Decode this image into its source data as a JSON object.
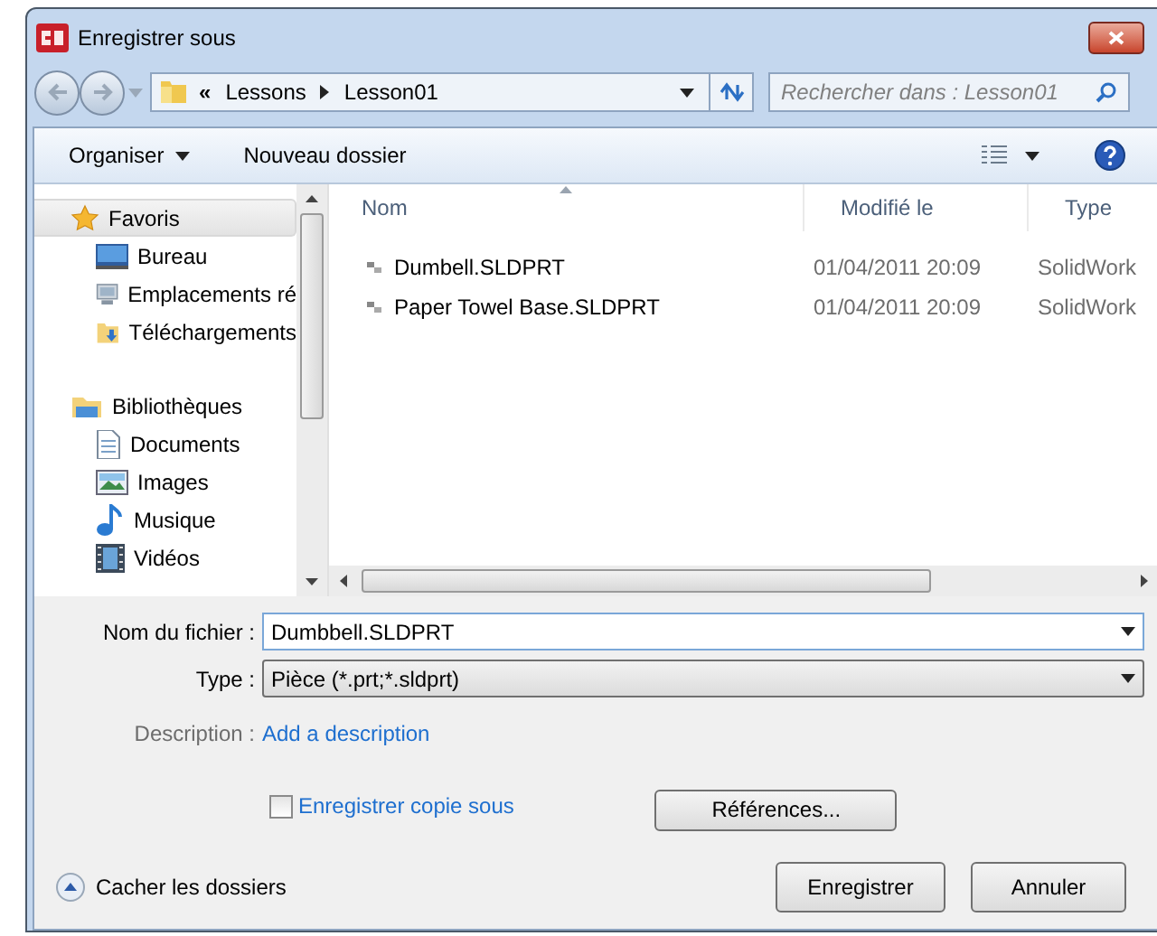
{
  "window": {
    "title": "Enregistrer sous"
  },
  "address": {
    "overflow": "«",
    "crumbs": [
      "Lessons",
      "Lesson01"
    ]
  },
  "search": {
    "placeholder": "Rechercher dans : Lesson01"
  },
  "toolbar": {
    "organize": "Organiser",
    "new_folder": "Nouveau dossier"
  },
  "nav": [
    {
      "label": "Favoris",
      "selected": true,
      "children": [
        {
          "label": "Bureau"
        },
        {
          "label": "Emplacements ré"
        },
        {
          "label": "Téléchargements"
        }
      ]
    },
    {
      "label": "Bibliothèques",
      "selected": false,
      "children": [
        {
          "label": "Documents"
        },
        {
          "label": "Images"
        },
        {
          "label": "Musique"
        },
        {
          "label": "Vidéos"
        }
      ]
    }
  ],
  "table": {
    "columns": [
      {
        "label": "Nom",
        "sorted": true
      },
      {
        "label": "Modifié le",
        "sorted": false
      },
      {
        "label": "Type",
        "sorted": false
      }
    ],
    "rows": [
      {
        "name": "Dumbell.SLDPRT",
        "modified": "01/04/2011 20:09",
        "type": "SolidWork"
      },
      {
        "name": "Paper Towel Base.SLDPRT",
        "modified": "01/04/2011 20:09",
        "type": "SolidWork"
      }
    ]
  },
  "form": {
    "filename_label": "Nom du fichier :",
    "filename": "Dumbbell.SLDPRT",
    "type_label": "Type :",
    "type": "Pièce (*.prt;*.sldprt)",
    "description_label": "Description :",
    "description_link": "Add a description",
    "copy_checkbox": {
      "label": "Enregistrer copie sous",
      "checked": false
    },
    "references_button": "Références..."
  },
  "footer": {
    "hide_folders": "Cacher les dossiers",
    "save": "Enregistrer",
    "cancel": "Annuler"
  }
}
